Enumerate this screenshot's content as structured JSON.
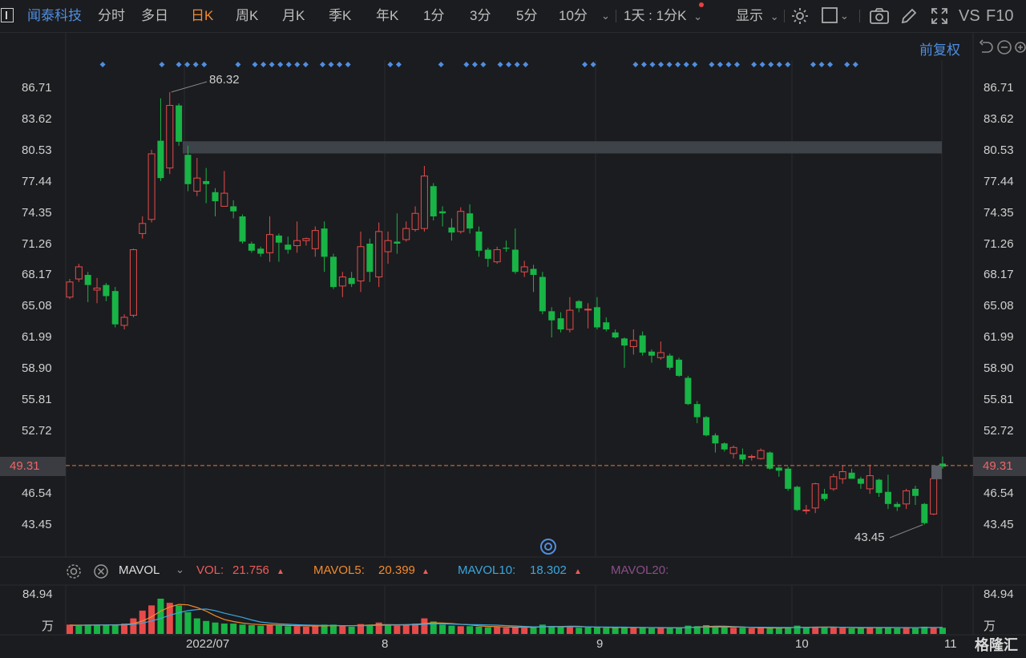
{
  "toolbar": {
    "stock_name": "闻泰科技",
    "tabs": [
      {
        "label": "分时",
        "active": false
      },
      {
        "label": "多日",
        "active": false
      },
      {
        "label": "日K",
        "active": true
      },
      {
        "label": "周K",
        "active": false
      },
      {
        "label": "月K",
        "active": false
      },
      {
        "label": "季K",
        "active": false
      },
      {
        "label": "年K",
        "active": false
      },
      {
        "label": "1分",
        "active": false
      },
      {
        "label": "3分",
        "active": false
      },
      {
        "label": "5分",
        "active": false
      },
      {
        "label": "10分",
        "active": false
      }
    ],
    "period_select": "1天 : 1分K",
    "display_label": "显示",
    "vs_label": "VS",
    "f10_label": "F10"
  },
  "subbar": {
    "adjust_label": "前复权"
  },
  "price_axis": {
    "ticks": [
      "86.71",
      "83.62",
      "80.53",
      "77.44",
      "74.35",
      "71.26",
      "68.17",
      "65.08",
      "61.99",
      "58.90",
      "55.81",
      "52.72",
      "46.54",
      "43.45"
    ],
    "tick_values": [
      86.71,
      83.62,
      80.53,
      77.44,
      74.35,
      71.26,
      68.17,
      65.08,
      61.99,
      58.9,
      55.81,
      52.72,
      46.54,
      43.45
    ],
    "current_price": "49.31",
    "current_value": 49.31
  },
  "annotations": {
    "high_label": "86.32",
    "low_label": "43.45"
  },
  "volume_panel": {
    "indicator": "MAVOL",
    "vol_label": "VOL:",
    "vol_value": "21.756",
    "mavol5_label": "MAVOL5:",
    "mavol5_value": "20.399",
    "mavol10_label": "MAVOL10:",
    "mavol10_value": "18.302",
    "mavol20_label": "MAVOL20:",
    "axis_top": "84.94",
    "axis_unit": "万"
  },
  "x_axis": {
    "labels": [
      "2022/07",
      "8",
      "9",
      "10",
      "11"
    ]
  },
  "watermark": "格隆汇",
  "colors": {
    "up": "#e84a4a",
    "down": "#18b446",
    "accent": "#f38a2c",
    "blue": "#4f8ee0",
    "dot": "#4f8ee0"
  },
  "chart_data": {
    "type": "candlestick",
    "ylim": [
      41.8,
      88.2
    ],
    "candles": [
      [
        66.0,
        67.5,
        65.8,
        67.8
      ],
      [
        67.8,
        69.0,
        67.5,
        69.3
      ],
      [
        68.2,
        67.2,
        65.5,
        68.5
      ],
      [
        66.7,
        66.9,
        65.4,
        67.9
      ],
      [
        67.2,
        66.1,
        65.6,
        67.4
      ],
      [
        66.6,
        63.3,
        63.0,
        67.0
      ],
      [
        63.2,
        64.0,
        62.8,
        64.3
      ],
      [
        64.2,
        70.7,
        64.0,
        70.8
      ],
      [
        72.3,
        73.3,
        71.8,
        74.0
      ],
      [
        73.7,
        80.2,
        73.4,
        80.6
      ],
      [
        81.5,
        77.8,
        77.5,
        85.7
      ],
      [
        78.8,
        85.0,
        78.2,
        86.32
      ],
      [
        85.0,
        81.4,
        81.0,
        85.2
      ],
      [
        80.1,
        77.2,
        76.5,
        81.0
      ],
      [
        76.5,
        77.8,
        76.0,
        79.8
      ],
      [
        77.5,
        77.2,
        75.3,
        78.8
      ],
      [
        76.4,
        75.5,
        74.0,
        76.8
      ],
      [
        75.0,
        76.3,
        75.0,
        78.5
      ],
      [
        75.0,
        74.5,
        73.8,
        75.6
      ],
      [
        74.0,
        71.5,
        71.3,
        74.2
      ],
      [
        71.3,
        70.6,
        70.4,
        71.5
      ],
      [
        70.8,
        70.3,
        70.0,
        71.0
      ],
      [
        70.4,
        72.2,
        69.5,
        74.0
      ],
      [
        72.1,
        71.4,
        69.5,
        72.3
      ],
      [
        71.2,
        70.7,
        70.3,
        72.0
      ],
      [
        71.1,
        71.6,
        70.4,
        73.5
      ],
      [
        71.6,
        71.8,
        71.1,
        71.9
      ],
      [
        70.8,
        72.6,
        70.0,
        73.0
      ],
      [
        72.8,
        70.0,
        68.5,
        73.5
      ],
      [
        70.0,
        67.0,
        66.8,
        70.3
      ],
      [
        67.1,
        68.0,
        66.0,
        68.5
      ],
      [
        67.9,
        67.3,
        67.0,
        68.5
      ],
      [
        67.6,
        71.0,
        66.5,
        72.5
      ],
      [
        71.3,
        68.5,
        67.5,
        71.8
      ],
      [
        68.0,
        72.5,
        67.0,
        73.4
      ],
      [
        70.5,
        71.6,
        69.3,
        72.5
      ],
      [
        71.5,
        71.3,
        70.3,
        74.3
      ],
      [
        71.7,
        72.8,
        71.5,
        73.5
      ],
      [
        72.7,
        74.3,
        72.5,
        75.0
      ],
      [
        72.8,
        78.0,
        72.5,
        79.0
      ],
      [
        77.0,
        74.0,
        73.6,
        77.3
      ],
      [
        74.5,
        74.3,
        73.0,
        75.0
      ],
      [
        72.9,
        72.4,
        71.6,
        73.8
      ],
      [
        72.5,
        74.5,
        72.3,
        74.9
      ],
      [
        74.3,
        72.8,
        72.3,
        75.2
      ],
      [
        72.5,
        70.6,
        70.0,
        73.0
      ],
      [
        70.7,
        69.8,
        69.0,
        70.9
      ],
      [
        69.5,
        70.7,
        69.3,
        71.0
      ],
      [
        70.9,
        70.8,
        70.5,
        71.6
      ],
      [
        70.7,
        68.5,
        68.3,
        72.8
      ],
      [
        68.5,
        69.0,
        68.0,
        69.6
      ],
      [
        68.8,
        68.2,
        66.5,
        69.2
      ],
      [
        68.0,
        64.6,
        64.3,
        68.5
      ],
      [
        64.6,
        63.7,
        62.0,
        65.0
      ],
      [
        63.9,
        62.8,
        62.5,
        64.5
      ],
      [
        62.8,
        64.7,
        62.5,
        66.0
      ],
      [
        65.6,
        64.9,
        64.5,
        65.7
      ],
      [
        64.8,
        64.8,
        62.9,
        65.4
      ],
      [
        65.0,
        63.0,
        62.8,
        66.0
      ],
      [
        63.5,
        62.8,
        62.6,
        64.0
      ],
      [
        62.5,
        62.0,
        61.9,
        62.8
      ],
      [
        61.9,
        61.2,
        59.0,
        62.0
      ],
      [
        61.1,
        61.7,
        60.3,
        62.8
      ],
      [
        62.2,
        60.5,
        60.2,
        62.6
      ],
      [
        60.6,
        60.2,
        59.5,
        60.8
      ],
      [
        60.0,
        60.5,
        59.8,
        61.6
      ],
      [
        60.2,
        59.0,
        58.8,
        60.4
      ],
      [
        59.8,
        58.2,
        58.1,
        60.0
      ],
      [
        58.0,
        55.4,
        55.3,
        58.2
      ],
      [
        55.4,
        54.1,
        53.5,
        55.7
      ],
      [
        54.1,
        52.3,
        52.2,
        54.2
      ],
      [
        52.3,
        51.5,
        50.6,
        52.5
      ],
      [
        51.5,
        50.9,
        50.7,
        51.6
      ],
      [
        50.5,
        51.1,
        50.0,
        51.3
      ],
      [
        50.4,
        49.9,
        49.5,
        51.0
      ],
      [
        50.2,
        50.2,
        49.8,
        50.4
      ],
      [
        50.0,
        50.8,
        49.9,
        51.0
      ],
      [
        50.6,
        49.0,
        48.9,
        50.7
      ],
      [
        49.1,
        48.8,
        48.2,
        49.2
      ],
      [
        49.0,
        47.0,
        46.8,
        49.2
      ],
      [
        47.2,
        44.9,
        44.8,
        47.3
      ],
      [
        44.9,
        44.9,
        44.5,
        45.4
      ],
      [
        45.1,
        47.5,
        44.6,
        47.6
      ],
      [
        46.5,
        46.0,
        45.8,
        47.0
      ],
      [
        47.0,
        48.2,
        46.8,
        48.5
      ],
      [
        48.0,
        48.7,
        47.5,
        49.3
      ],
      [
        48.6,
        48.0,
        48.0,
        49.0
      ],
      [
        48.0,
        47.5,
        47.0,
        48.2
      ],
      [
        47.0,
        48.3,
        46.5,
        49.4
      ],
      [
        47.9,
        46.6,
        46.2,
        48.0
      ],
      [
        46.7,
        45.5,
        45.0,
        48.4
      ],
      [
        45.5,
        45.2,
        44.8,
        45.7
      ],
      [
        45.5,
        46.8,
        45.0,
        47.0
      ],
      [
        47.0,
        46.3,
        45.4,
        47.3
      ],
      [
        45.5,
        43.6,
        43.45,
        45.6
      ],
      [
        44.5,
        48.0,
        44.4,
        48.1
      ],
      [
        49.5,
        49.2,
        49.0,
        50.2
      ]
    ],
    "volumes": [
      [
        18,
        1
      ],
      [
        17,
        0
      ],
      [
        18,
        0
      ],
      [
        17,
        0
      ],
      [
        17,
        0
      ],
      [
        18,
        0
      ],
      [
        20,
        1
      ],
      [
        30,
        1
      ],
      [
        45,
        1
      ],
      [
        55,
        1
      ],
      [
        68,
        0
      ],
      [
        60,
        1
      ],
      [
        55,
        0
      ],
      [
        42,
        0
      ],
      [
        30,
        0
      ],
      [
        25,
        0
      ],
      [
        22,
        0
      ],
      [
        20,
        0
      ],
      [
        20,
        0
      ],
      [
        18,
        0
      ],
      [
        17,
        0
      ],
      [
        16,
        0
      ],
      [
        18,
        1
      ],
      [
        16,
        0
      ],
      [
        15,
        0
      ],
      [
        15,
        1
      ],
      [
        14,
        1
      ],
      [
        15,
        1
      ],
      [
        18,
        0
      ],
      [
        18,
        0
      ],
      [
        16,
        1
      ],
      [
        14,
        0
      ],
      [
        19,
        1
      ],
      [
        18,
        0
      ],
      [
        22,
        1
      ],
      [
        17,
        0
      ],
      [
        16,
        1
      ],
      [
        17,
        1
      ],
      [
        20,
        1
      ],
      [
        30,
        1
      ],
      [
        24,
        0
      ],
      [
        18,
        0
      ],
      [
        16,
        0
      ],
      [
        15,
        1
      ],
      [
        15,
        0
      ],
      [
        14,
        0
      ],
      [
        13,
        0
      ],
      [
        13,
        1
      ],
      [
        12,
        1
      ],
      [
        14,
        1
      ],
      [
        12,
        1
      ],
      [
        13,
        0
      ],
      [
        18,
        0
      ],
      [
        15,
        0
      ],
      [
        14,
        0
      ],
      [
        14,
        1
      ],
      [
        12,
        0
      ],
      [
        13,
        0
      ],
      [
        13,
        0
      ],
      [
        12,
        0
      ],
      [
        12,
        0
      ],
      [
        13,
        0
      ],
      [
        12,
        1
      ],
      [
        13,
        0
      ],
      [
        11,
        0
      ],
      [
        12,
        1
      ],
      [
        11,
        0
      ],
      [
        12,
        0
      ],
      [
        16,
        0
      ],
      [
        15,
        0
      ],
      [
        17,
        0
      ],
      [
        14,
        0
      ],
      [
        13,
        0
      ],
      [
        12,
        1
      ],
      [
        12,
        0
      ],
      [
        11,
        1
      ],
      [
        12,
        1
      ],
      [
        12,
        0
      ],
      [
        11,
        0
      ],
      [
        13,
        0
      ],
      [
        16,
        0
      ],
      [
        12,
        0
      ],
      [
        14,
        1
      ],
      [
        12,
        0
      ],
      [
        13,
        1
      ],
      [
        12,
        1
      ],
      [
        11,
        0
      ],
      [
        11,
        0
      ],
      [
        13,
        1
      ],
      [
        12,
        0
      ],
      [
        13,
        0
      ],
      [
        11,
        0
      ],
      [
        12,
        1
      ],
      [
        11,
        0
      ],
      [
        14,
        0
      ],
      [
        13,
        1
      ],
      [
        12,
        0
      ]
    ],
    "mavol5": [
      17,
      17,
      17.3,
      17.5,
      17.5,
      17.6,
      18,
      20,
      25,
      33,
      44,
      52,
      57,
      56,
      51,
      44,
      35,
      28,
      24,
      21,
      19,
      18,
      17.5,
      17,
      16.4,
      16,
      15.6,
      15.4,
      15.6,
      16,
      16,
      16,
      16.4,
      17,
      17.8,
      18,
      17.8,
      18,
      18.4,
      20,
      21.4,
      21,
      20,
      18.6,
      17.6,
      15.6,
      14.6,
      14,
      13.4,
      13.2,
      12.8,
      12.8,
      13.8,
      14.4,
      14.4,
      14.8,
      14.6,
      13.6,
      13.2,
      12.8,
      12.4,
      12.6,
      12.4,
      12.4,
      12.2,
      12.2,
      11.8,
      11.8,
      12.4,
      13.2,
      14.2,
      14.8,
      15,
      14.2,
      13.6,
      12.4,
      12,
      11.6,
      11.6,
      11.8,
      12.8,
      12.8,
      13.2,
      13.4,
      13.4,
      12.8,
      12.4,
      11.8,
      12,
      12,
      12.2,
      12,
      12.4,
      12,
      12.6,
      12.4,
      12.6
    ],
    "mavol10": [
      16,
      16.5,
      16.8,
      17,
      17.2,
      17.3,
      17.5,
      18.5,
      21,
      25,
      30,
      36,
      41,
      45,
      47,
      48,
      45,
      40,
      36,
      32,
      27,
      23,
      21,
      19.5,
      18.7,
      17.8,
      17.2,
      16.8,
      16.5,
      16.3,
      16,
      15.9,
      16,
      16.2,
      16.6,
      17,
      17.1,
      17.3,
      17.8,
      18.6,
      19.5,
      19.5,
      19.2,
      18.5,
      18,
      17.8,
      17.5,
      17,
      16,
      15.5,
      14.5,
      13.8,
      13.8,
      14,
      13.8,
      14,
      13.9,
      13.7,
      13.5,
      13.4,
      13.2,
      13.1,
      12.8,
      12.6,
      12.4,
      12.3,
      12.2,
      12.1,
      12.4,
      12.8,
      13.2,
      13.3,
      13.3,
      13.3,
      13.2,
      13,
      13,
      12.8,
      12.5,
      12.5,
      12.4,
      12.4,
      12.6,
      12.7,
      12.9,
      12.9,
      12.8,
      12.6,
      12.6,
      12.6,
      12.5,
      12.3,
      12.2,
      12.2,
      12.4,
      12.3,
      12.4
    ]
  }
}
